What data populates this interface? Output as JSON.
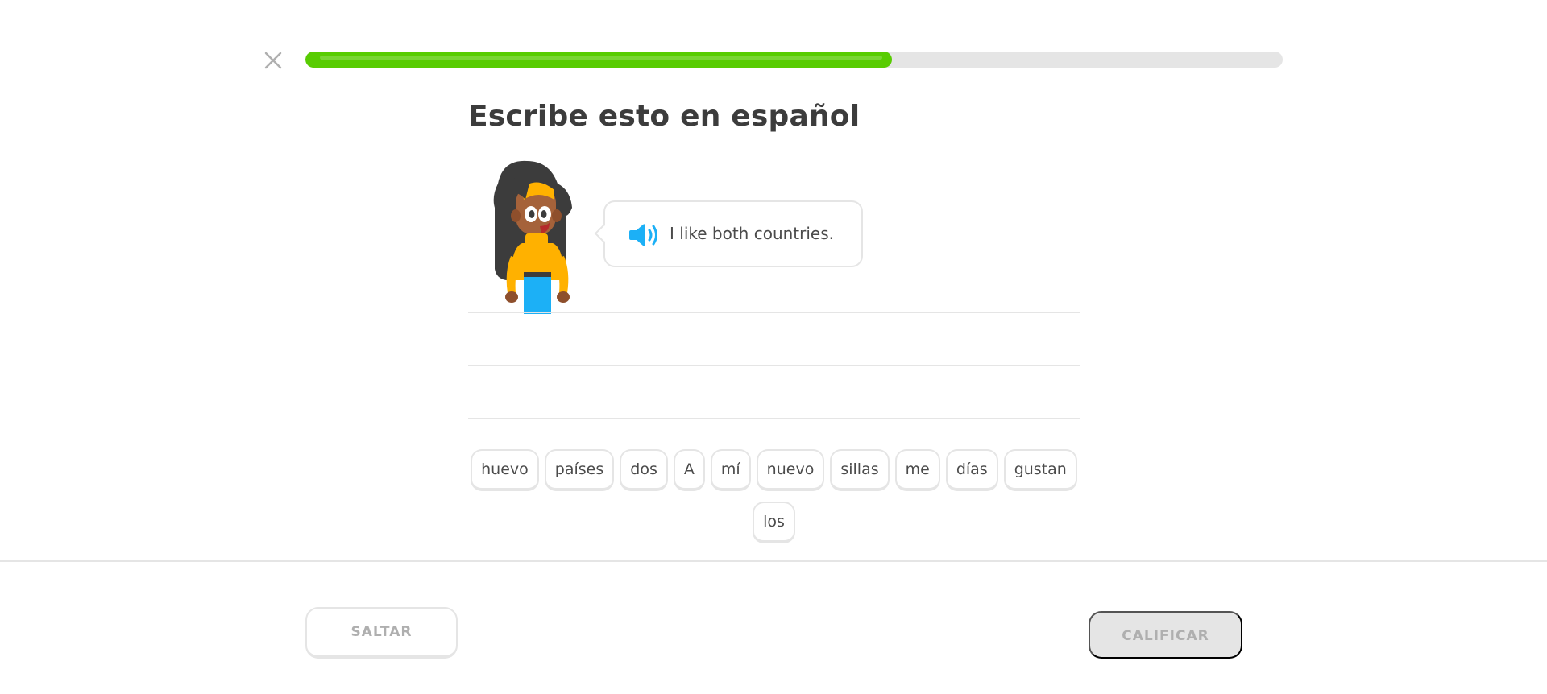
{
  "header": {
    "close_icon": "close-icon",
    "progress": 0.6
  },
  "challenge": {
    "title": "Escribe esto en español",
    "prompt": "I like both countries.",
    "speaker_icon": "speaker-icon"
  },
  "word_bank": {
    "row1": [
      "huevo",
      "países",
      "dos",
      "A",
      "mí",
      "nuevo",
      "sillas",
      "me",
      "días",
      "gustan"
    ],
    "row2": [
      "los"
    ]
  },
  "footer": {
    "skip_label": "SALTAR",
    "check_label": "CALIFICAR"
  },
  "colors": {
    "progress": "#58cc02",
    "speaker": "#1cb0f6",
    "border": "#e5e5e5",
    "disabled_text": "#afafaf"
  }
}
